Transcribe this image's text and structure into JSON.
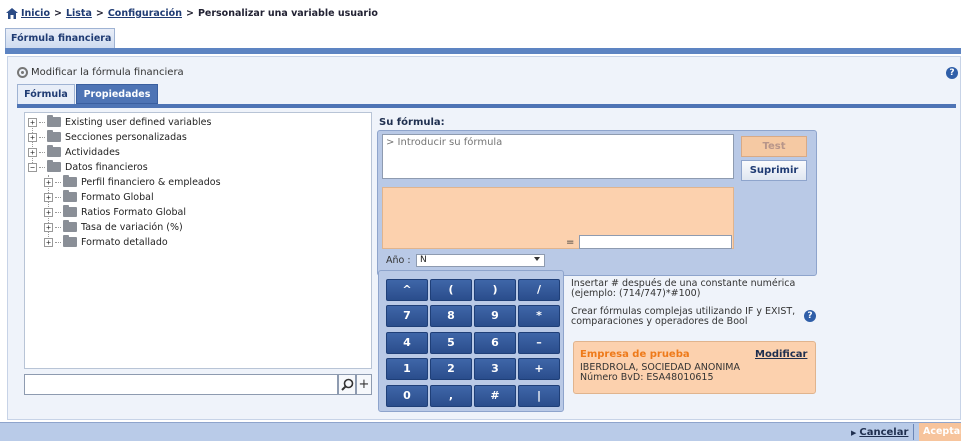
{
  "breadcrumb": {
    "home": "Inicio",
    "list": "Lista",
    "config": "Configuración",
    "current": "Personalizar una variable usuario",
    "sep": ">"
  },
  "page_tab": "Fórmula financiera",
  "panel": {
    "title": "Modificar la fórmula financiera"
  },
  "tabs": {
    "formula": "Fórmula",
    "properties": "Propiedades"
  },
  "tree": {
    "items": [
      "Existing user defined variables",
      "Secciones personalizadas",
      "Actividades",
      "Datos financieros",
      "Perfil financiero & empleados",
      "Formato Global",
      "Ratios Formato Global",
      "Tasa de variación (%)",
      "Formato detallado"
    ]
  },
  "search": {
    "value": ""
  },
  "formula": {
    "label": "Su fórmula:",
    "placeholder": "> Introducir su fórmula",
    "equals": "=",
    "test_label": "Test",
    "delete_label": "Suprimir",
    "year_label": "Año :",
    "year_value": "N"
  },
  "keypad": {
    "keys": [
      "^",
      "(",
      ")",
      "/",
      "7",
      "8",
      "9",
      "*",
      "4",
      "5",
      "6",
      "–",
      "1",
      "2",
      "3",
      "+",
      "0",
      ",",
      "#",
      "|"
    ]
  },
  "hints": {
    "hint1": "Insertar # después de una constante numérica (ejemplo: (714/747)*#100)",
    "hint2": "Crear fórmulas complejas utilizando IF y EXIST, comparaciones y operadores de Bool"
  },
  "company": {
    "title": "Empresa de prueba",
    "modify": "Modificar",
    "name": "IBERDROLA, SOCIEDAD ANONIMA",
    "bvd": "Número BvD: ESA48010615"
  },
  "footer": {
    "cancel": "Cancelar",
    "accept": "Aceptar"
  },
  "colors": {
    "accent": "#4e74b5",
    "orange_panel": "#fcd1ae",
    "orange_text": "#ee7a1a",
    "keypad_key": "#2f55a0",
    "accept_button": "#f7c49c"
  },
  "icons": [
    "home-icon",
    "gear-icon",
    "help-icon",
    "folder-icon",
    "search-icon",
    "plus-icon"
  ]
}
